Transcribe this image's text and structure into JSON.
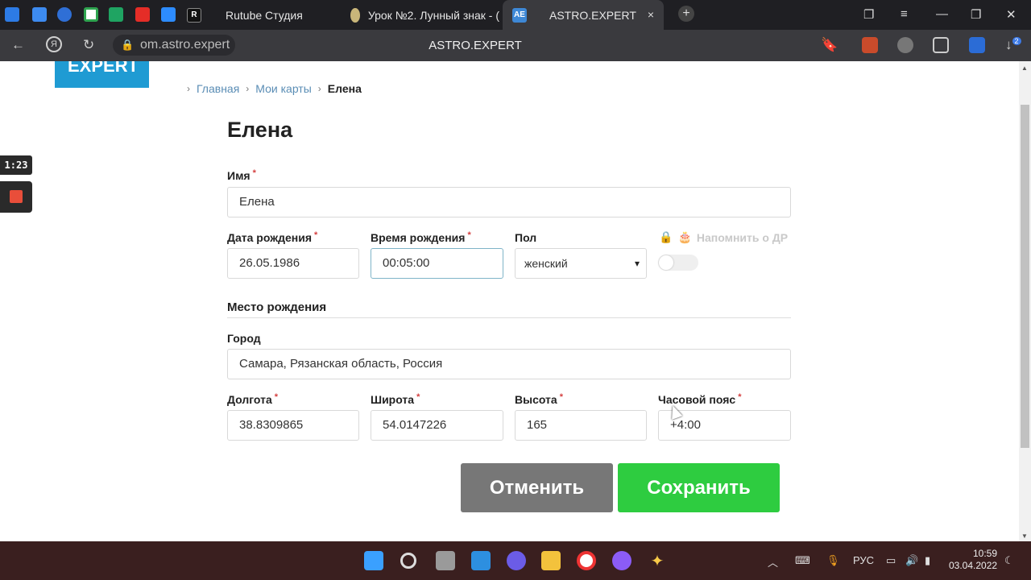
{
  "browser": {
    "tabs": [
      {
        "title": "Rutube Студия",
        "active": false
      },
      {
        "title": "Урок №2. Лунный знак - (",
        "active": false
      },
      {
        "title": "ASTRO.EXPERT",
        "active": true,
        "favicon_text": "AE"
      }
    ],
    "address": "om.astro.expert",
    "page_title": "ASTRO.EXPERT",
    "download_badge": "2",
    "new_tab_label": "+",
    "close_tab": "×"
  },
  "site": {
    "logo_text": "EXPERT",
    "breadcrumbs": [
      "Главная",
      "Мои карты",
      "Елена"
    ]
  },
  "form": {
    "heading": "Елена",
    "name_label": "Имя",
    "name_value": "Елена",
    "birth_date_label": "Дата рождения",
    "birth_date_value": "26.05.1986",
    "birth_time_label": "Время рождения",
    "birth_time_value": "00:05:00",
    "gender_label": "Пол",
    "gender_value": "женский",
    "remind_label": "Напомнить о ДР",
    "remind_enabled": false,
    "place_section": "Место рождения",
    "city_label": "Город",
    "city_value": "Самара, Рязанская область, Россия",
    "longitude_label": "Долгота",
    "longitude_value": "38.8309865",
    "latitude_label": "Широта",
    "latitude_value": "54.0147226",
    "altitude_label": "Высота",
    "altitude_value": "165",
    "timezone_label": "Часовой пояс",
    "timezone_value": "+4:00",
    "required_mark": "*",
    "cancel_label": "Отменить",
    "save_label": "Сохранить"
  },
  "recorder": {
    "elapsed": "1:23"
  },
  "taskbar": {
    "lang": "РУС",
    "time": "10:59",
    "date": "03.04.2022"
  },
  "colors": {
    "brand": "#1f9bd3",
    "save": "#2ecc40",
    "cancel": "#777777",
    "required": "#d43f3f",
    "link": "#5a8db5"
  }
}
